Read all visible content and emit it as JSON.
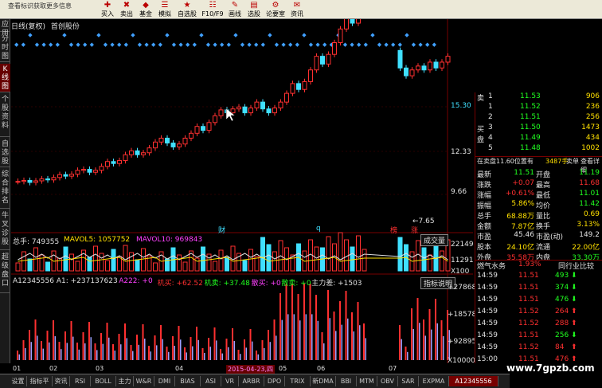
{
  "toolbar": {
    "search_placeholder": "查看标识获取更多信息",
    "buttons": [
      "买入",
      "卖出",
      "基金",
      "模拟",
      "自选股",
      "F10/F9",
      "画线",
      "选股",
      "论要室",
      "资讯"
    ]
  },
  "sidetabs": [
    "应用",
    "分时图",
    "K线图",
    "个股资料",
    "自选股",
    "综合排名",
    "牛叉诊股",
    "超级盘口"
  ],
  "kline": {
    "title": "日线(复权)",
    "stock": "首创股份",
    "axis_labels": [
      "15.30",
      "12.33",
      "9.66"
    ],
    "marks": [
      "财",
      "q",
      "榜",
      "涨"
    ],
    "low_label": "7.65"
  },
  "volume": {
    "header": [
      {
        "text": "总手: 749355",
        "color": "white"
      },
      {
        "text": "MAVOL5: 1057752",
        "color": "yellow"
      },
      {
        "text": "MAVOL10: 969843",
        "color": "magenta"
      }
    ],
    "button": "成交量",
    "axis_labels": [
      "22149",
      "11291",
      "X100"
    ]
  },
  "indicator": {
    "header": [
      {
        "text": "A12345556 A1: +237137623",
        "color": "white"
      },
      {
        "text": "A222: +0",
        "color": "magenta"
      },
      {
        "text": "机买: +62.52",
        "color": "red"
      },
      {
        "text": "机卖: +37.48",
        "color": "green"
      },
      {
        "text": "散买: +0",
        "color": "magenta"
      },
      {
        "text": "散卖: +0",
        "color": "green"
      },
      {
        "text": "主力差: +1503",
        "color": "white"
      }
    ],
    "button": "指标说明",
    "axis_labels": [
      "+278684",
      "+185789",
      "+92895",
      "X10000"
    ]
  },
  "dates": [
    "01",
    "02",
    "03",
    "04",
    "2015-04-23,四",
    "05",
    "06",
    "07"
  ],
  "order_book": [
    {
      "side": "卖",
      "level": "1",
      "price": "11.53",
      "vol": "906",
      "pc": "green"
    },
    {
      "side": "",
      "level": "1",
      "price": "11.52",
      "vol": "236",
      "pc": "green"
    },
    {
      "side": "",
      "level": "2",
      "price": "11.51",
      "vol": "256",
      "pc": "green"
    },
    {
      "side": "买",
      "level": "3",
      "price": "11.50",
      "vol": "1473",
      "pc": "green"
    },
    {
      "side": "盘",
      "level": "4",
      "price": "11.49",
      "vol": "434",
      "pc": "green"
    },
    {
      "side": "",
      "level": "5",
      "price": "11.48",
      "vol": "1002",
      "pc": "green"
    }
  ],
  "order_info": "在卖盘11.60位置有",
  "order_info_vol": "3487手",
  "order_info_tag": "卖单",
  "order_info_link": "查看详细",
  "quote": [
    {
      "l1": "最新",
      "v1": "11.51",
      "c1": "green",
      "l2": "开盘",
      "v2": "11.19",
      "c2": "green"
    },
    {
      "l1": "涨跌",
      "v1": "+0.07",
      "c1": "red",
      "l2": "最高",
      "v2": "11.68",
      "c2": "red"
    },
    {
      "l1": "涨幅",
      "v1": "+0.61%",
      "c1": "red",
      "l2": "最低",
      "v2": "11.01",
      "c2": "green"
    },
    {
      "l1": "振幅",
      "v1": "5.86%",
      "c1": "yellow",
      "l2": "均价",
      "v2": "11.42",
      "c2": "green"
    },
    {
      "l1": "总手",
      "v1": "68.88万",
      "c1": "yellow",
      "l2": "量比",
      "v2": "0.69",
      "c2": "yellow"
    },
    {
      "l1": "金额",
      "v1": "7.87亿",
      "c1": "yellow",
      "l2": "换手",
      "v2": "3.13%",
      "c2": "yellow"
    },
    {
      "l1": "市盈",
      "v1": "45.46",
      "c1": "white",
      "l2": "市盈(动)",
      "v2": "149.2",
      "c2": "white"
    },
    {
      "l1": "股本",
      "v1": "24.10亿",
      "c1": "yellow",
      "l2": "流通",
      "v2": "22.00亿",
      "c2": "yellow"
    },
    {
      "l1": "外盘",
      "v1": "35.58万",
      "c1": "red",
      "l2": "内盘",
      "v2": "33.30万",
      "c2": "green"
    }
  ],
  "sector": {
    "name": "燃气水务",
    "pct": "1.93%",
    "link": "同行业比较"
  },
  "ticks": [
    {
      "time": "14:59",
      "price": "11.51",
      "vol": "493",
      "dir": "down"
    },
    {
      "time": "14:59",
      "price": "11.51",
      "vol": "374",
      "dir": "down"
    },
    {
      "time": "14:59",
      "price": "11.51",
      "vol": "476",
      "dir": "down"
    },
    {
      "time": "14:59",
      "price": "11.52",
      "vol": "264",
      "dir": "up"
    },
    {
      "time": "14:59",
      "price": "11.52",
      "vol": "288",
      "dir": "up"
    },
    {
      "time": "14:59",
      "price": "11.51",
      "vol": "256",
      "dir": "down"
    },
    {
      "time": "14:59",
      "price": "11.52",
      "vol": "84",
      "dir": "up"
    },
    {
      "time": "15:00",
      "price": "11.51",
      "vol": "476",
      "dir": "up"
    }
  ],
  "bottom_tabs": [
    "设置",
    "指标平台",
    "资讯",
    "RSI",
    "BOLL",
    "主力",
    "W&R",
    "DMI",
    "BIAS",
    "ASI",
    "VR",
    "ARBR",
    "DPO",
    "TRIX",
    "新DMA",
    "BBI",
    "MTM",
    "OBV",
    "SAR",
    "EXPMA",
    "A12345556"
  ],
  "watermark": "www.7gpzb.com",
  "colors": {
    "up": "#ff3030",
    "down": "#40e0ff",
    "ma5": "#e0e0e0",
    "ma10": "#ffe000",
    "panel_border": "#700000"
  }
}
